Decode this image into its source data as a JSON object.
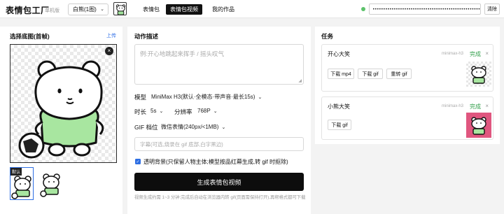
{
  "header": {
    "brand": "表情包工厂",
    "brand_sub": "单机版",
    "character_select": "白熊(1图)",
    "tabs": [
      {
        "label": "表情包",
        "active": false
      },
      {
        "label": "表情包视频",
        "active": true
      },
      {
        "label": "我的作品",
        "active": false
      }
    ],
    "api_key_masked": "••••••••••••••••••••••••••••••••••••••••••••••••••••••••••••••",
    "clear_label": "清除",
    "status_color": "#5cc26b"
  },
  "left": {
    "title": "选择底图(首帧)",
    "upload_label": "上传",
    "preview_close": "×",
    "default_badge": "默认"
  },
  "middle": {
    "action_label": "动作描述",
    "action_placeholder": "例:开心地跳起来挥手 / 摇头叹气",
    "model_label": "模型",
    "model_value": "MiniMax H3(默认·全模态·带声音·最长15s)",
    "duration_label": "时长",
    "duration_value": "5s",
    "resolution_label": "分辨率",
    "resolution_value": "768P",
    "gif_label": "GIF 档位",
    "gif_value": "微信表情(240px/<1MB)",
    "caption_placeholder": "字幕(可选,烧录在 gif 底部,白字黑边)",
    "transparent_label": "透明背景(只保留人物主体;模型按品红幕生成,转 gif 时抠除)",
    "transparent_checked": true,
    "generate_label": "生成表情包视频",
    "hint": "视频生成约需 1~3 分钟;完成后自动在浏览器内转 gif(页面需保持打开),再帮格式都可下载"
  },
  "tasks": {
    "title": "任务",
    "items": [
      {
        "name": "开心大笑",
        "model": "minimax-h3",
        "status": "完成",
        "status_color": "#2f9e48",
        "buttons": [
          "下载 mp4",
          "下载 gif",
          "重转 gif"
        ]
      },
      {
        "name": "小熊大笑",
        "model": "minimax-h3",
        "status": "完成",
        "status_color": "#2f9e48",
        "buttons": [
          "下载 gif"
        ]
      }
    ]
  }
}
